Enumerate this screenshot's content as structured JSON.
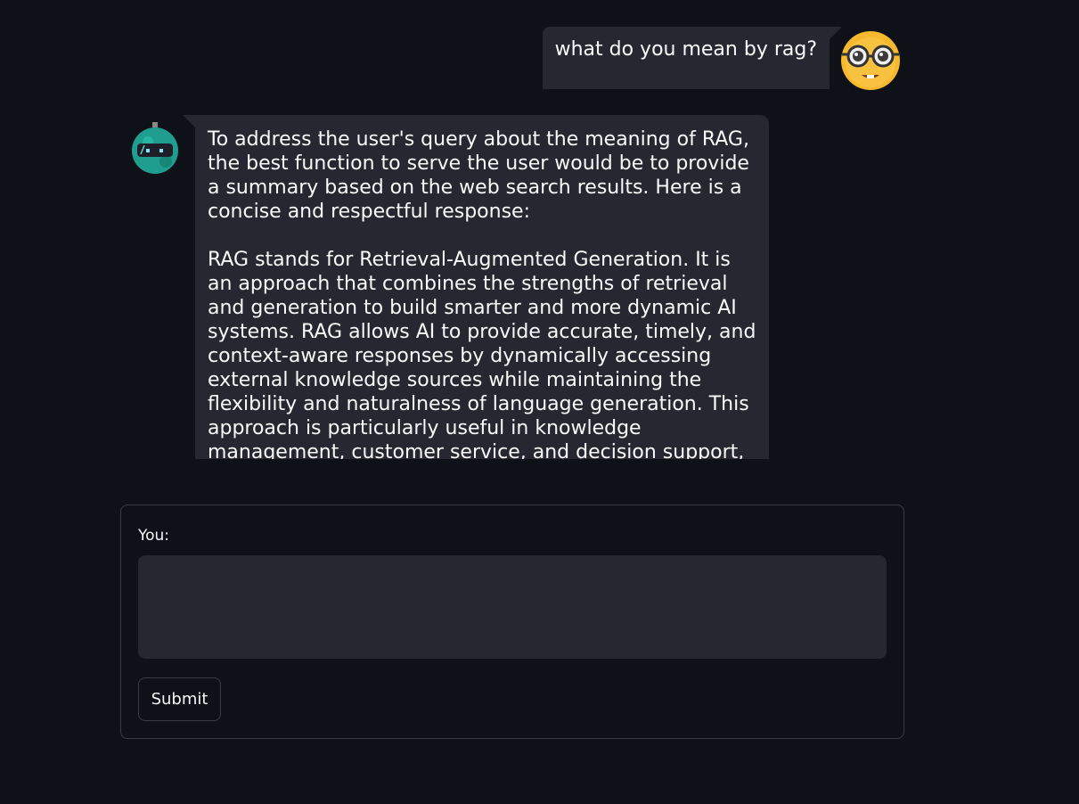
{
  "chat": {
    "user_message": "what do you mean by rag?",
    "user_avatar_icon": "nerd-face-icon",
    "bot_avatar_icon": "robot-icon",
    "bot_message": {
      "paragraph_1": "To address the user's query about the meaning of RAG, the best function to serve the user would be to provide a summary based on the web search results. Here is a concise and respectful response:",
      "paragraph_2": "RAG stands for Retrieval-Augmented Generation. It is an approach that combines the strengths of retrieval and generation to build smarter and more dynamic AI systems. RAG allows AI to provide accurate, timely, and context-aware responses by dynamically accessing external knowledge sources while maintaining the flexibility and naturalness of language generation. This approach is particularly useful in knowledge management, customer service, and decision support, as"
    }
  },
  "form": {
    "label": "You:",
    "input_value": "",
    "submit_label": "Submit"
  },
  "colors": {
    "background": "#0e1117",
    "bubble": "#262730",
    "avatar_yellow": "#f5b82e",
    "avatar_teal": "#1f9e8f"
  }
}
